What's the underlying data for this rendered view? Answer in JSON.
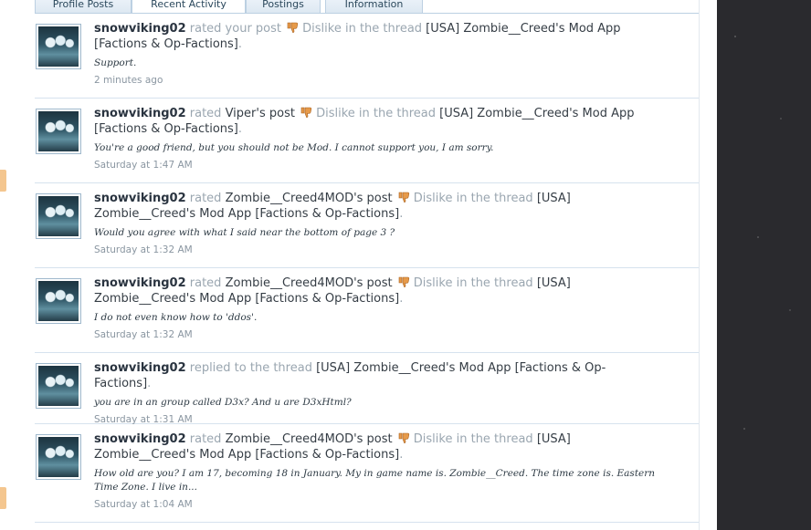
{
  "tabs": [
    {
      "label": "Profile Posts"
    },
    {
      "label": "Recent Activity"
    },
    {
      "label": "Postings"
    },
    {
      "label": "Information"
    }
  ],
  "feed": [
    {
      "user": "snowviking02",
      "action": "rated your post",
      "rating": "Dislike",
      "in_thread": "in the thread",
      "thread": "[USA] Zombie__Creed's Mod App [Factions & Op-Factions]",
      "quote": "Support.",
      "time": "2 minutes ago"
    },
    {
      "user": "snowviking02",
      "action": "rated",
      "target": "Viper's post",
      "rating": "Dislike",
      "in_thread": "in the thread",
      "thread": "[USA] Zombie__Creed's Mod App [Factions & Op-Factions]",
      "quote": "You're a good friend, but you should not be Mod. I cannot support you, I am sorry.",
      "time": "Saturday at 1:47 AM"
    },
    {
      "user": "snowviking02",
      "action": "rated",
      "target": "Zombie__Creed4MOD's post",
      "rating": "Dislike",
      "in_thread": "in the thread",
      "thread": "[USA] Zombie__Creed's Mod App [Factions & Op-Factions]",
      "quote": "Would you agree with what I said near the bottom of page 3 ?",
      "time": "Saturday at 1:32 AM"
    },
    {
      "user": "snowviking02",
      "action": "rated",
      "target": "Zombie__Creed4MOD's post",
      "rating": "Dislike",
      "in_thread": "in the thread",
      "thread": "[USA] Zombie__Creed's Mod App [Factions & Op-Factions]",
      "quote": "I do not even know how to 'ddos'.",
      "time": "Saturday at 1:32 AM"
    },
    {
      "user": "snowviking02",
      "action": "replied to the thread",
      "thread": "[USA] Zombie__Creed's Mod App [Factions & Op-Factions]",
      "quote": "you are in an group called D3x? And u are D3xHtml?",
      "time": "Saturday at 1:31 AM"
    },
    {
      "user": "snowviking02",
      "action": "rated",
      "target": "Zombie__Creed4MOD's post",
      "rating": "Dislike",
      "in_thread": "in the thread",
      "thread": "[USA] Zombie__Creed's Mod App [Factions & Op-Factions]",
      "quote": "How old are you? I am 17, becoming 18 in January. My in game name is. Zombie__Creed. The time zone is. Eastern Time Zone. I live in...",
      "time": "Saturday at 1:04 AM"
    }
  ],
  "period": ".",
  "colors": {
    "tab_border": "#bcd0e2",
    "muted_text": "#9aa6b0",
    "dislike_icon": "#e69a4a"
  },
  "icons": {
    "dislike": "thumbs-down-icon"
  }
}
